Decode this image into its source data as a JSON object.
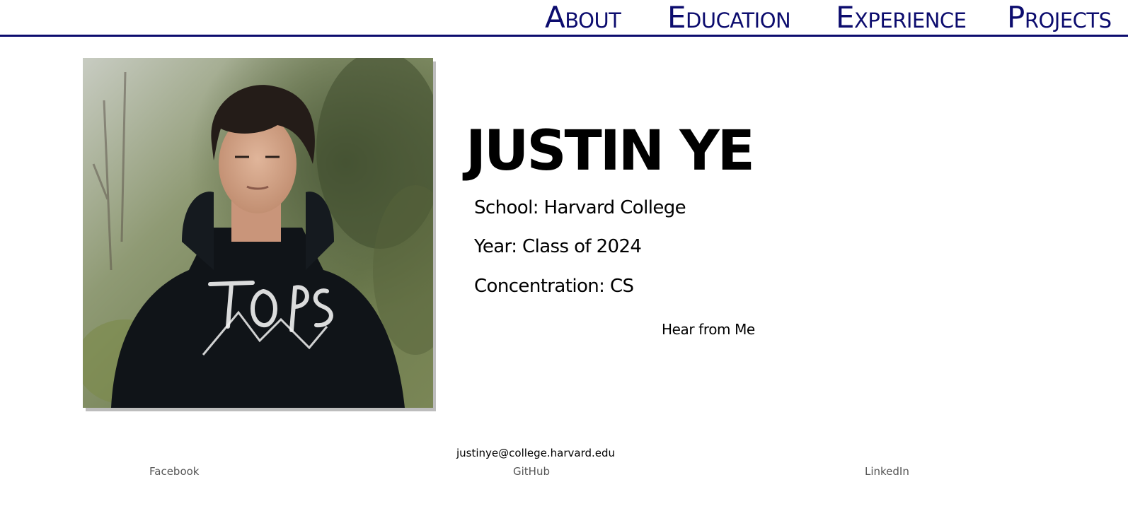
{
  "nav": {
    "about": "About",
    "education": "Education",
    "experience": "Experience",
    "projects": "Projects"
  },
  "profile": {
    "name": "JUSTIN YE",
    "school": "School: Harvard College",
    "year": "Year: Class of 2024",
    "concentration": "Concentration: CS",
    "hear_link": "Hear from Me"
  },
  "footer": {
    "email": "justinye@college.harvard.edu",
    "links": {
      "facebook": "Facebook",
      "github": "GitHub",
      "linkedin": "LinkedIn"
    }
  },
  "colors": {
    "nav_text": "#0c0c6e",
    "text": "#000000",
    "footer_link": "#555555",
    "photo_shadow": "#bdbdbd"
  }
}
